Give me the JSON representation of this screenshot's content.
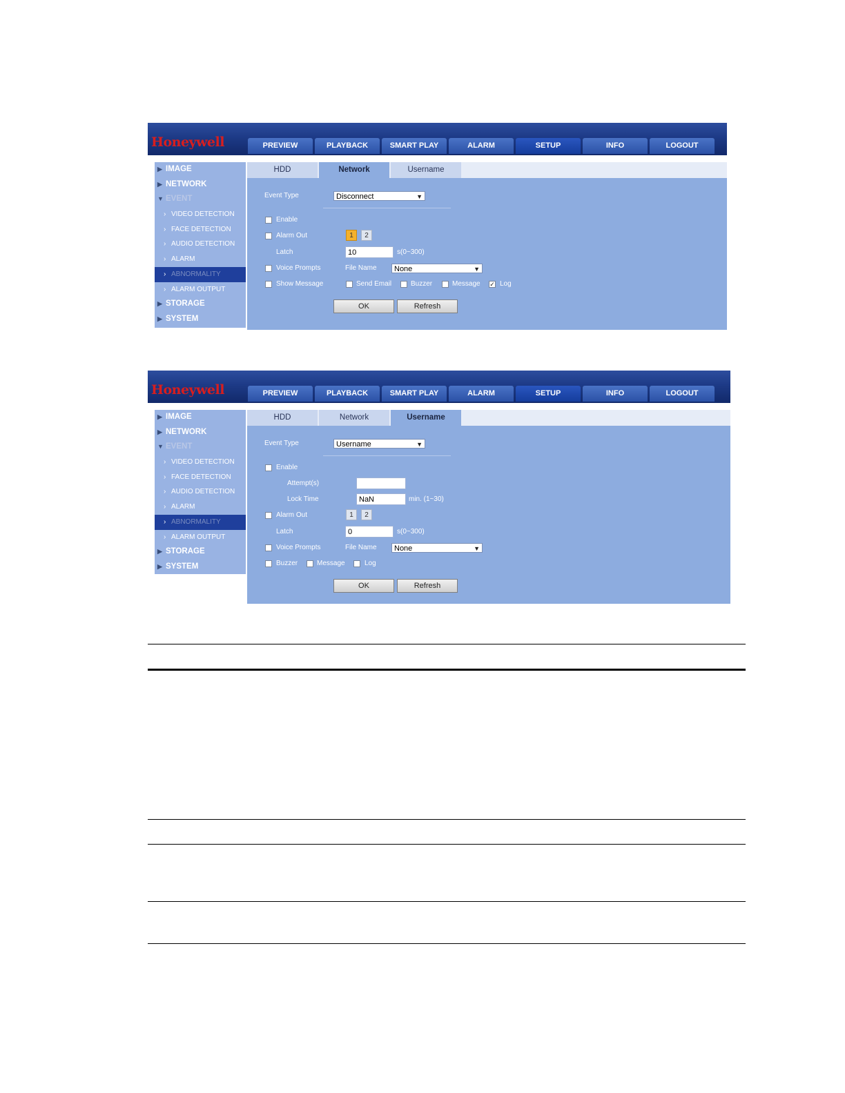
{
  "brand": "Honeywell",
  "nav": [
    "PREVIEW",
    "PLAYBACK",
    "SMART PLAY",
    "ALARM",
    "SETUP",
    "INFO",
    "LOGOUT"
  ],
  "nav_active": "SETUP",
  "sidebar": {
    "image": "IMAGE",
    "network": "NETWORK",
    "event": "EVENT",
    "video_detection": "VIDEO DETECTION",
    "face_detection": "FACE DETECTION",
    "audio_detection": "AUDIO DETECTION",
    "alarm": "ALARM",
    "abnormality": "ABNORMALITY",
    "alarm_output": "ALARM OUTPUT",
    "storage": "STORAGE",
    "system": "SYSTEM"
  },
  "tabs": [
    "HDD",
    "Network",
    "Username"
  ],
  "screen1": {
    "active_tab": "Network",
    "event_type_label": "Event Type",
    "event_type_value": "Disconnect",
    "enable": "Enable",
    "alarm_out": "Alarm Out",
    "alarm_out_channels": [
      "1",
      "2"
    ],
    "alarm_out_selected": "1",
    "latch": "Latch",
    "latch_value": "10",
    "latch_range": "s(0~300)",
    "voice_prompts": "Voice Prompts",
    "file_name": "File Name",
    "file_name_value": "None",
    "show_message": "Show Message",
    "send_email": "Send Email",
    "buzzer": "Buzzer",
    "message": "Message",
    "log": "Log",
    "log_checked": true,
    "ok": "OK",
    "refresh": "Refresh"
  },
  "screen2": {
    "active_tab": "Username",
    "event_type_label": "Event Type",
    "event_type_value": "Username",
    "enable": "Enable",
    "attempts": "Attempt(s)",
    "attempts_value": "",
    "lock_time": "Lock Time",
    "lock_time_value": "NaN",
    "lock_time_range": "min. (1~30)",
    "alarm_out": "Alarm Out",
    "alarm_out_channels": [
      "1",
      "2"
    ],
    "latch": "Latch",
    "latch_value": "0",
    "latch_range": "s(0~300)",
    "voice_prompts": "Voice Prompts",
    "file_name": "File Name",
    "file_name_value": "None",
    "buzzer": "Buzzer",
    "message": "Message",
    "log": "Log",
    "ok": "OK",
    "refresh": "Refresh"
  },
  "colors": {
    "topbar": "#1d3a86",
    "panel": "#8dacdf",
    "sidebar": "#99b3e3",
    "selected_chip": "#f4b12c",
    "logo": "#d81e1e"
  }
}
